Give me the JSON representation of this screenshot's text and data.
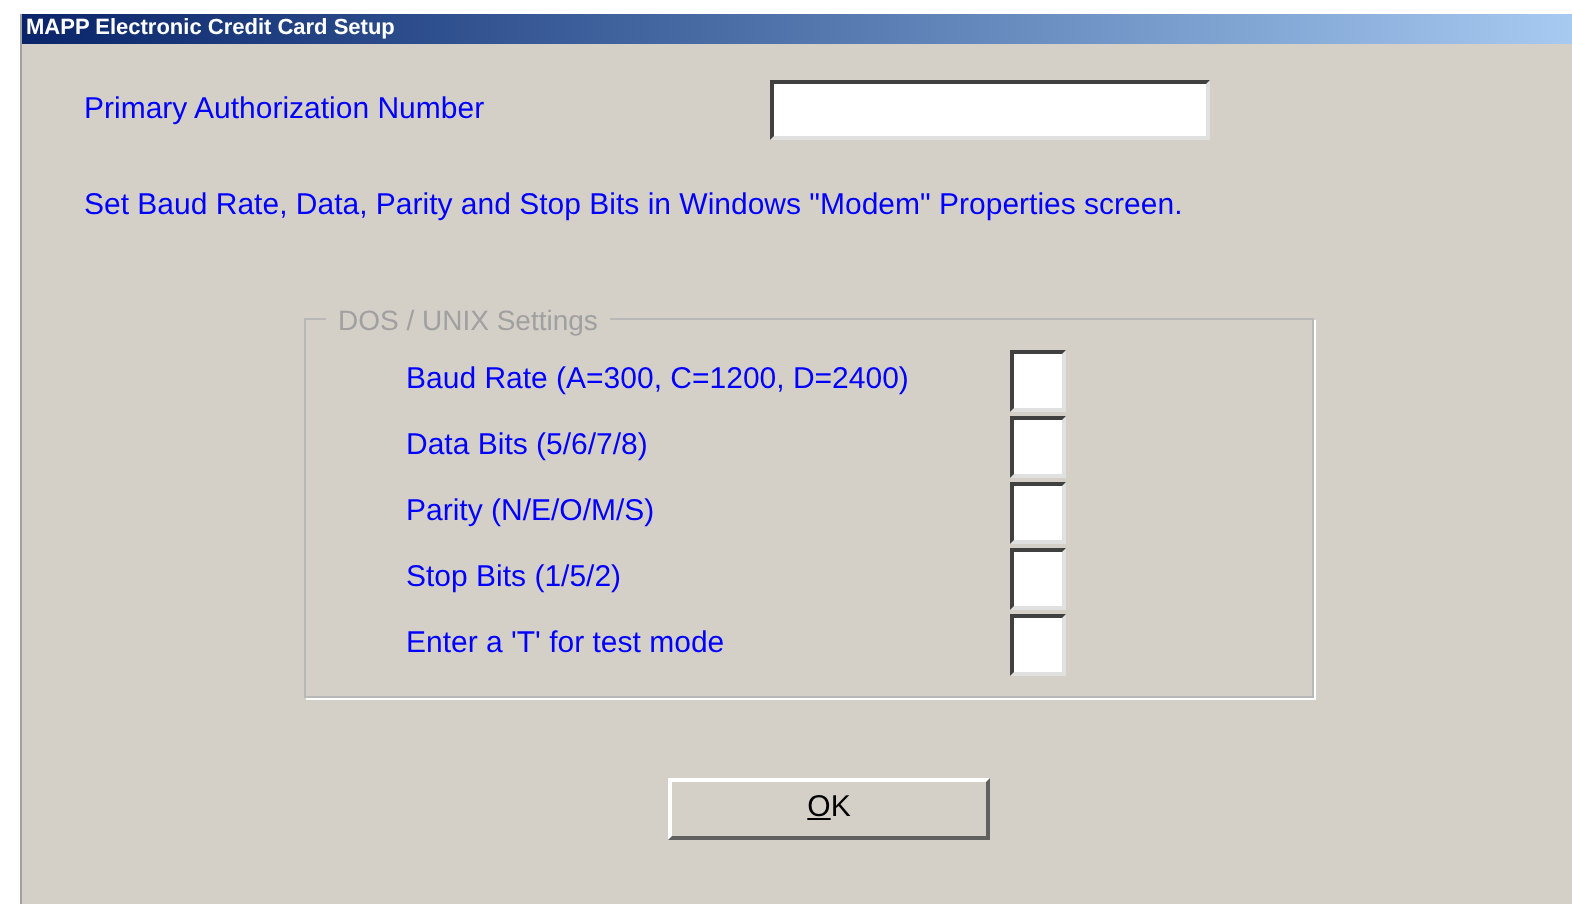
{
  "window": {
    "title": "MAPP Electronic Credit Card Setup"
  },
  "primary_authorization": {
    "label": "Primary Authorization Number"
  },
  "note": "Set Baud Rate, Data, Parity and Stop Bits in Windows \"Modem\" Properties screen.",
  "dos_unix_settings": {
    "title": "DOS / UNIX Settings",
    "fields": [
      {
        "label": "Baud Rate (A=300, C=1200, D=2400)"
      },
      {
        "label": "Data Bits (5/6/7/8)"
      },
      {
        "label": "Parity (N/E/O/M/S)"
      },
      {
        "label": "Stop Bits (1/5/2)"
      },
      {
        "label": "Enter a 'T' for test mode"
      }
    ]
  },
  "buttons": [
    {
      "label": "OK"
    }
  ]
}
